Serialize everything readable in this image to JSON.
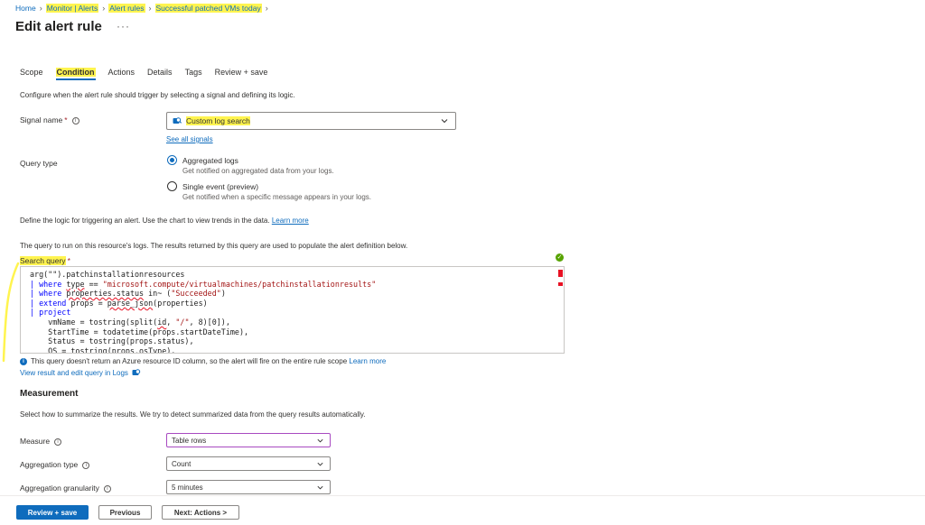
{
  "breadcrumb": [
    {
      "label": "Home",
      "highlight": false
    },
    {
      "label": "Monitor | Alerts",
      "highlight": true
    },
    {
      "label": "Alert rules",
      "highlight": true
    },
    {
      "label": "Successful patched VMs today",
      "highlight": true
    }
  ],
  "page": {
    "title": "Edit alert rule",
    "more": "···"
  },
  "tabs": [
    {
      "label": "Scope",
      "active": false
    },
    {
      "label": "Condition",
      "active": true
    },
    {
      "label": "Actions",
      "active": false
    },
    {
      "label": "Details",
      "active": false
    },
    {
      "label": "Tags",
      "active": false
    },
    {
      "label": "Review + save",
      "active": false
    }
  ],
  "condition": {
    "description": "Configure when the alert rule should trigger by selecting a signal and defining its logic.",
    "signal_label": "Signal name",
    "required_mark": "*",
    "signal_value": "Custom log search",
    "see_all_signals": "See all signals",
    "query_type_label": "Query type",
    "query_types": [
      {
        "title": "Aggregated logs",
        "subtitle": "Get notified on aggregated data from your logs.",
        "selected": true
      },
      {
        "title": "Single event (preview)",
        "subtitle": "Get notified when a specific message appears in your logs.",
        "selected": false
      }
    ],
    "logic_text": "Define the logic for triggering an alert. Use the chart to view trends in the data.",
    "learn_more": "Learn more",
    "query_intro": "The query to run on this resource's logs. The results returned by this query are used to populate the alert definition below.",
    "search_query_label": "Search query",
    "query_lines": [
      "arg(\"\").patchinstallationresources",
      "| where type == \"microsoft.compute/virtualmachines/patchinstallationresults\"",
      "| where properties.status in~ (\"Succeeded\")",
      "| extend props = parse_json(properties)",
      "| project",
      "    vmName = tostring(split(id, \"/\", 8)[0]),",
      "    StartTime = todatetime(props.startDateTime),",
      "    Status = tostring(props.status),",
      "    OS = tostring(props.osType),"
    ],
    "query_warning": "This query doesn't return an Azure resource ID column, so the alert will fire on the entire rule scope",
    "warning_learn_more": "Learn more",
    "view_in_logs": "View result and edit query in Logs"
  },
  "measurement": {
    "title": "Measurement",
    "description": "Select how to summarize the results. We try to detect summarized data from the query results automatically.",
    "fields": [
      {
        "label": "Measure",
        "value": "Table rows"
      },
      {
        "label": "Aggregation type",
        "value": "Count"
      },
      {
        "label": "Aggregation granularity",
        "value": "5 minutes"
      }
    ]
  },
  "footer": {
    "review_save": "Review + save",
    "previous": "Previous",
    "next": "Next: Actions >"
  },
  "colors": {
    "accent": "#0f6cbd",
    "highlight": "#fff44f",
    "success": "#57a300",
    "error": "#e81123"
  },
  "icons": [
    "search-icon",
    "info-icon",
    "chevron-down-icon",
    "check-circle-icon",
    "logs-icon"
  ]
}
